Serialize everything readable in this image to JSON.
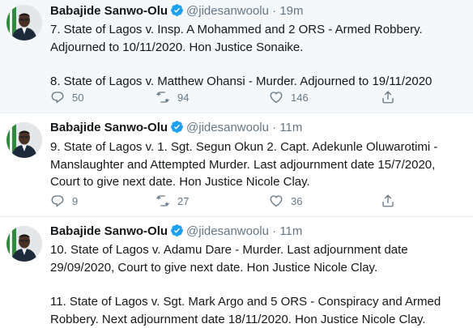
{
  "tweets": [
    {
      "name": "Babajide Sanwo-Olu",
      "handle": "@jidesanwoolu",
      "dot": "·",
      "time": "19m",
      "lines": [
        "7. State of Lagos v. Insp. A Mohammed and 2 ORS - Armed Robbery.",
        "Adjourned to 10/11/2020. Hon Justice Sonaike.",
        "",
        "8. State of Lagos v. Matthew Ohansi - Murder. Adjourned to 19/11/2020"
      ],
      "replies": "50",
      "retweets": "94",
      "likes": "146"
    },
    {
      "name": "Babajide Sanwo-Olu",
      "handle": "@jidesanwoolu",
      "dot": "·",
      "time": "11m",
      "lines": [
        "9. State of Lagos v. 1. Sgt. Segun Okun 2. Capt. Adekunle Oluwarotimi -",
        "Manslaughter and Attempted Murder. Last adjournment date 15/7/2020,",
        "Court to give next date. Hon Justice Nicole Clay."
      ],
      "replies": "9",
      "retweets": "27",
      "likes": "36"
    },
    {
      "name": "Babajide Sanwo-Olu",
      "handle": "@jidesanwoolu",
      "dot": "·",
      "time": "11m",
      "lines": [
        "10. State of Lagos v. Adamu Dare - Murder. Last adjournment date",
        "29/09/2020, Court to give next date. Hon Justice Nicole Clay.",
        "",
        "11. State of Lagos v. Sgt. Mark Argo and 5 ORS - Conspiracy and Armed",
        "Robbery. Next adjournment date 18/11/2020. Hon Justice Nicole Clay."
      ]
    }
  ],
  "colors": {
    "verified": "#1da1f2",
    "muted": "#657786",
    "text": "#14171a",
    "highlight_bg": "#f5f8fa"
  },
  "icons": [
    "reply-icon",
    "retweet-icon",
    "like-icon",
    "share-icon",
    "verified-badge-icon"
  ]
}
